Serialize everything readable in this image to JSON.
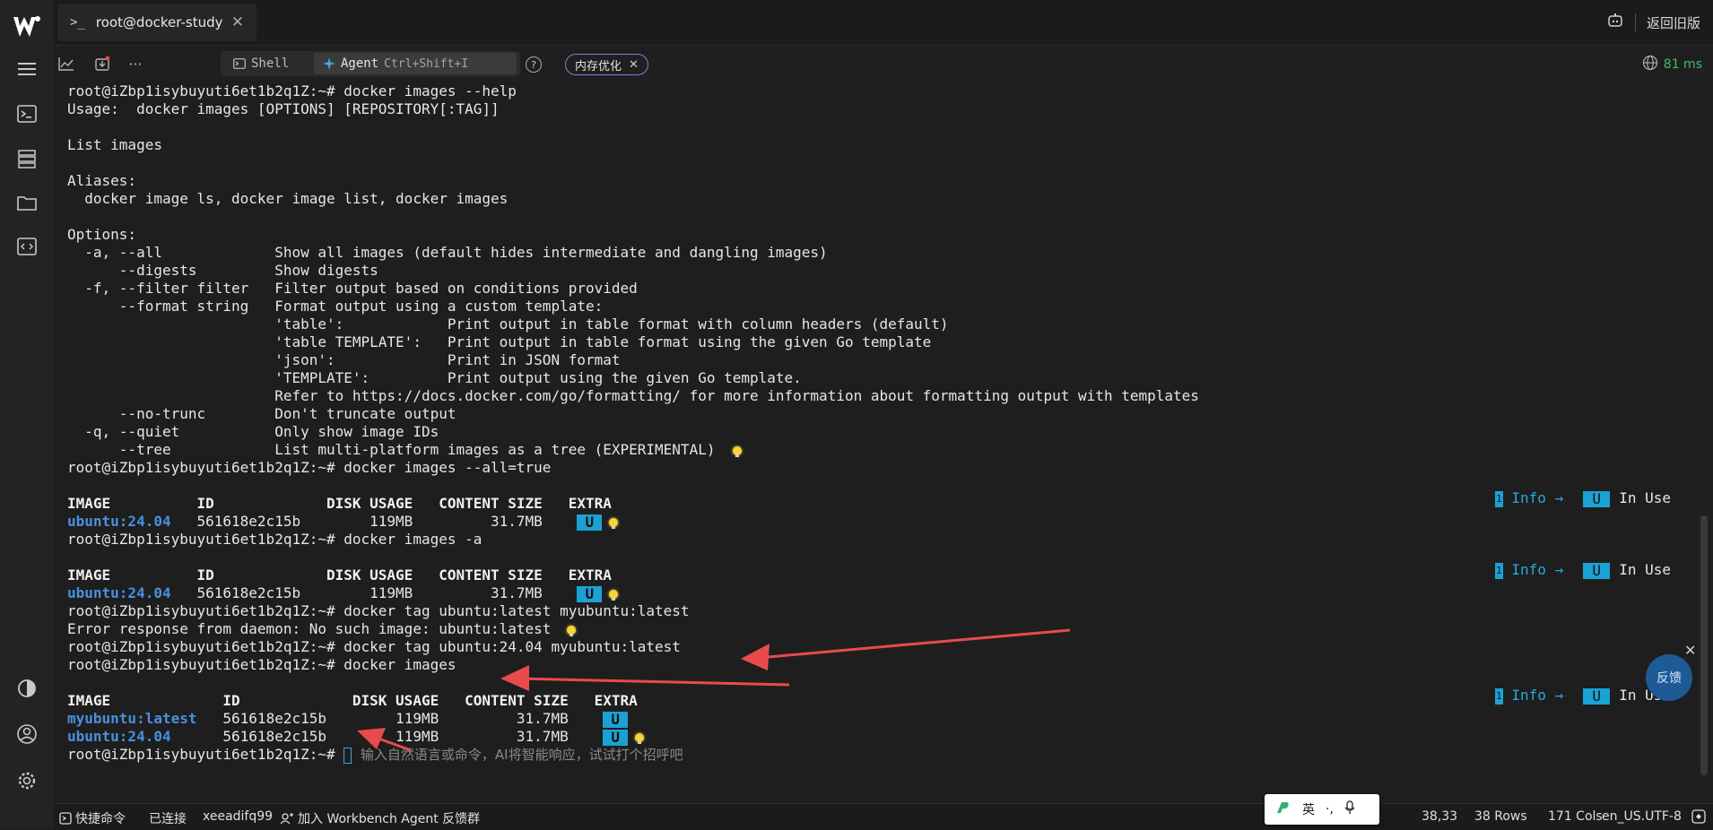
{
  "tab": {
    "prompt_icon": ">_",
    "title": "root@docker-study",
    "close": "✕"
  },
  "topright": {
    "old_version": "返回旧版",
    "robot_icon": "robot-icon"
  },
  "toolbar": {
    "shell_label": "Shell",
    "agent_label": "Agent",
    "agent_shortcut": "Ctrl+Shift+I",
    "help": "?",
    "chip_label": "内存优化",
    "chip_close": "✕",
    "more": "···",
    "latency": "81 ms"
  },
  "terminal": {
    "lines": [
      "root@iZbp1isybuyuti6et1b2q1Z:~# docker images --help",
      "Usage:  docker images [OPTIONS] [REPOSITORY[:TAG]]",
      "",
      "List images",
      "",
      "Aliases:",
      "  docker image ls, docker image list, docker images",
      "",
      "Options:",
      "  -a, --all             Show all images (default hides intermediate and dangling images)",
      "      --digests         Show digests",
      "  -f, --filter filter   Filter output based on conditions provided",
      "      --format string   Format output using a custom template:",
      "                        'table':            Print output in table format with column headers (default)",
      "                        'table TEMPLATE':   Print output in table format using the given Go template",
      "                        'json':             Print in JSON format",
      "                        'TEMPLATE':         Print output using the given Go template.",
      "                        Refer to https://docs.docker.com/go/formatting/ for more information about formatting output with templates",
      "      --no-trunc        Don't truncate output",
      "  -q, --quiet           Only show image IDs",
      "      --tree            List multi-platform images as a tree (EXPERIMENTAL)",
      "root@iZbp1isybuyuti6et1b2q1Z:~# docker images --all=true"
    ],
    "header1": "IMAGE          ID             DISK USAGE   CONTENT SIZE   EXTRA",
    "row1": {
      "image": "ubuntu:24.04",
      "rest": "   561618e2c15b        119MB         31.7MB    "
    },
    "cmd2": "root@iZbp1isybuyuti6et1b2q1Z:~# docker images -a",
    "header2": "IMAGE          ID             DISK USAGE   CONTENT SIZE   EXTRA",
    "row2": {
      "image": "ubuntu:24.04",
      "rest": "   561618e2c15b        119MB         31.7MB    "
    },
    "cmd3": "root@iZbp1isybuyuti6et1b2q1Z:~# docker tag ubuntu:latest myubuntu:latest",
    "err3": "Error response from daemon: No such image: ubuntu:latest",
    "cmd4": "root@iZbp1isybuyuti6et1b2q1Z:~# docker tag ubuntu:24.04 myubuntu:latest",
    "cmd5": "root@iZbp1isybuyuti6et1b2q1Z:~# docker images",
    "header3": "IMAGE             ID             DISK USAGE   CONTENT SIZE   EXTRA",
    "row3a": {
      "image": "myubuntu:latest",
      "rest": "   561618e2c15b        119MB         31.7MB    "
    },
    "row3b": {
      "image": "ubuntu:24.04",
      "rest": "      561618e2c15b        119MB         31.7MB    "
    },
    "prompt": "root@iZbp1isybuyuti6et1b2q1Z:~# ",
    "input_placeholder": "输入自然语言或命令，AI将智能响应，试试打个招呼吧",
    "badge_u": "U"
  },
  "info_hint": {
    "num": "1",
    "label": "Info →",
    "badge": "U",
    "text": "In Use"
  },
  "feedback": {
    "label": "反馈",
    "close": "✕"
  },
  "status": {
    "quick_cmd": "快捷命令",
    "connected": "已连接",
    "user": "xeeadifq99",
    "join": "加入 Workbench Agent 反馈群",
    "position": "38,33",
    "rows": "38 Rows",
    "cols": "171 Cols",
    "encoding": "en_US.UTF-8"
  },
  "ime": {
    "lang": "英",
    "punct": "·,"
  },
  "colors": {
    "accent": "#1aa2d4",
    "link": "#4a8fe0",
    "latency": "#3fbf6a",
    "arrow": "#e84b4b"
  }
}
